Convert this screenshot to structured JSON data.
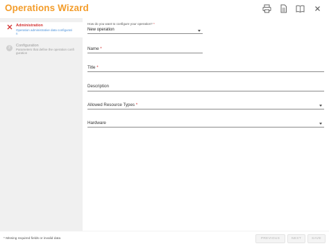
{
  "header": {
    "title": "Operations Wizard",
    "icons": [
      "print-icon",
      "document-icon",
      "help-book-icon",
      "close-icon"
    ]
  },
  "sidebar": {
    "steps": [
      {
        "title": "Administration",
        "subtitle": "Operation administrative data configurati",
        "subtitle2": "n",
        "status": "error"
      },
      {
        "number": "2",
        "title": "Configuration",
        "subtitle": "Parameters that define the operation confi",
        "subtitle2": "guration",
        "status": "pending"
      }
    ]
  },
  "form": {
    "configure": {
      "label": "How do you want to configure your operation?",
      "required": "*",
      "value": "New operation"
    },
    "name": {
      "label": "Name",
      "required": "*"
    },
    "title": {
      "label": "Title",
      "required": "*"
    },
    "description": {
      "label": "Description"
    },
    "allowed_resource_types": {
      "label": "Allowed Resource Types",
      "required": "*"
    },
    "hardware": {
      "label": "Hardware"
    }
  },
  "footer": {
    "note": "* Missing required fields or invalid data",
    "buttons": {
      "previous": "PREVIOUS",
      "next": "NEXT",
      "save": "SAVE"
    }
  },
  "colors": {
    "title": "#f39c2a",
    "error": "#d32f2f",
    "link": "#4a90d9",
    "sidebar_bg": "#f0f0f0"
  }
}
